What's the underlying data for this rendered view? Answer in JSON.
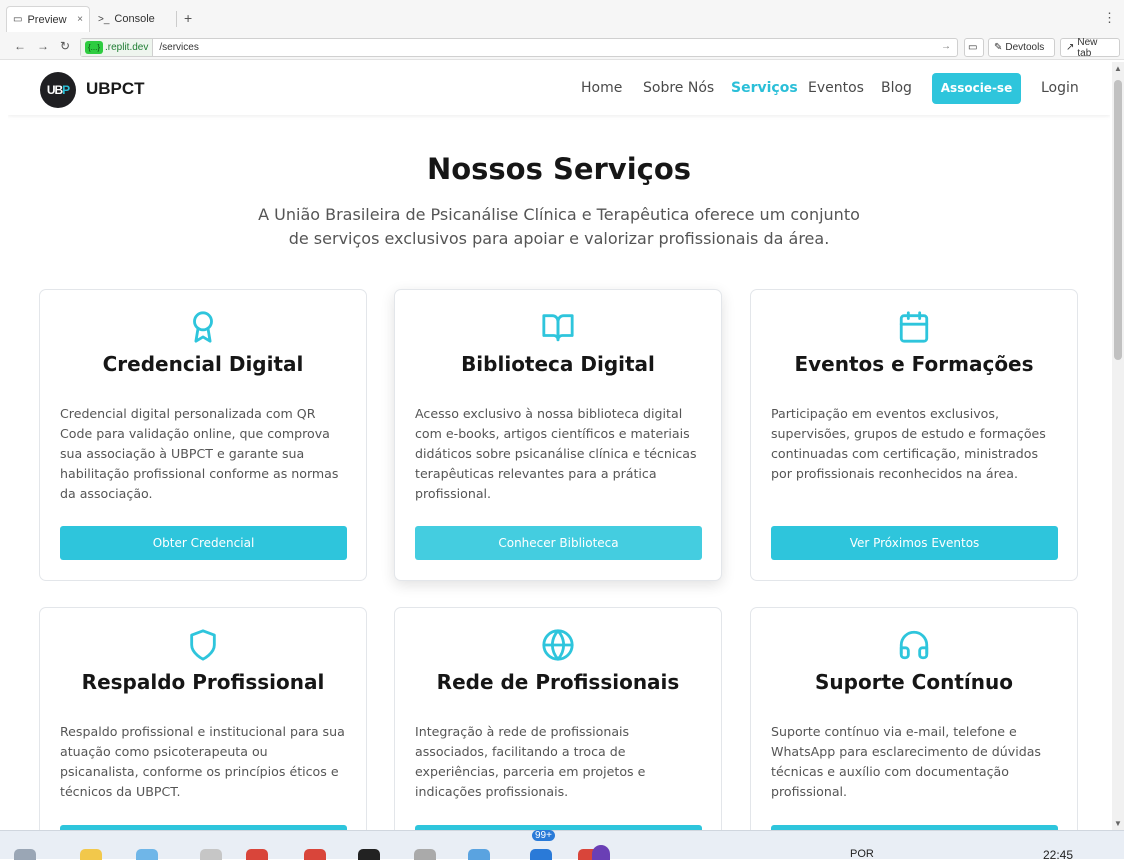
{
  "browser": {
    "tabs": [
      {
        "label": "Preview",
        "icon": "monitor-icon"
      },
      {
        "label": "Console",
        "icon": "terminal-icon"
      }
    ],
    "url_host": ".replit.dev",
    "url_path": "/services",
    "devtools_label": "Devtools",
    "newtab_label": "New tab"
  },
  "site": {
    "logo_text": "UBPCT",
    "logo_mark_a": "UB",
    "logo_mark_b": "P",
    "nav": [
      "Home",
      "Sobre Nós",
      "Serviços",
      "Eventos",
      "Blog"
    ],
    "active_nav": "Serviços",
    "join_label": "Associe-se",
    "login_label": "Login",
    "accent": "#2ec5dc"
  },
  "page": {
    "title": "Nossos Serviços",
    "intro": "A União Brasileira de Psicanálise Clínica e Terapêutica oferece um conjunto de serviços exclusivos para apoiar e valorizar profissionais da área."
  },
  "cards": [
    {
      "icon": "award-icon",
      "title": "Credencial Digital",
      "desc": "Credencial digital personalizada com QR Code para validação online, que comprova sua associação à UBPCT e garante sua habilitação profissional conforme as normas da associação.",
      "cta": "Obter Credencial"
    },
    {
      "icon": "book-open-icon",
      "title": "Biblioteca Digital",
      "desc": "Acesso exclusivo à nossa biblioteca digital com e-books, artigos científicos e materiais didáticos sobre psicanálise clínica e técnicas terapêuticas relevantes para a prática profissional.",
      "cta": "Conhecer Biblioteca"
    },
    {
      "icon": "calendar-icon",
      "title": "Eventos e Formações",
      "desc": "Participação em eventos exclusivos, supervisões, grupos de estudo e formações continuadas com certificação, ministrados por profissionais reconhecidos na área.",
      "cta": "Ver Próximos Eventos"
    },
    {
      "icon": "shield-icon",
      "title": "Respaldo Profissional",
      "desc": "Respaldo profissional e institucional para sua atuação como psicoterapeuta ou psicanalista, conforme os princípios éticos e técnicos da UBPCT.",
      "cta": ""
    },
    {
      "icon": "globe-icon",
      "title": "Rede de Profissionais",
      "desc": "Integração à rede de profissionais associados, facilitando a troca de experiências, parceria em projetos e indicações profissionais.",
      "cta": ""
    },
    {
      "icon": "headphones-icon",
      "title": "Suporte Contínuo",
      "desc": "Suporte contínuo via e-mail, telefone e WhatsApp para esclarecimento de dúvidas técnicas e auxílio com documentação profissional.",
      "cta": ""
    }
  ],
  "taskbar": {
    "lang": "POR",
    "time": "22:45",
    "badge": "99+"
  }
}
